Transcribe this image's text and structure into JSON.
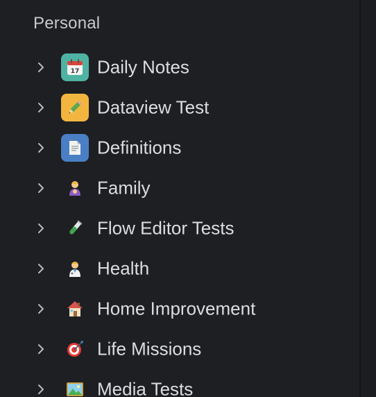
{
  "section": {
    "title": "Personal"
  },
  "items": [
    {
      "label": "Daily Notes",
      "icon": "calendar-icon",
      "tile_color": "#4fb3a3"
    },
    {
      "label": "Dataview Test",
      "icon": "pencil-icon",
      "tile_color": "#f2b640"
    },
    {
      "label": "Definitions",
      "icon": "document-icon",
      "tile_color": "#4a7fc4"
    },
    {
      "label": "Family",
      "icon": "family-icon"
    },
    {
      "label": "Flow Editor Tests",
      "icon": "test-tube-icon"
    },
    {
      "label": "Health",
      "icon": "health-worker-icon"
    },
    {
      "label": "Home Improvement",
      "icon": "house-icon"
    },
    {
      "label": "Life Missions",
      "icon": "target-icon"
    },
    {
      "label": "Media Tests",
      "icon": "picture-icon"
    }
  ],
  "colors": {
    "background": "#1e1f22",
    "text": "#dcdddf",
    "section_text": "#c8c9cc",
    "chevron": "#b9babd"
  }
}
